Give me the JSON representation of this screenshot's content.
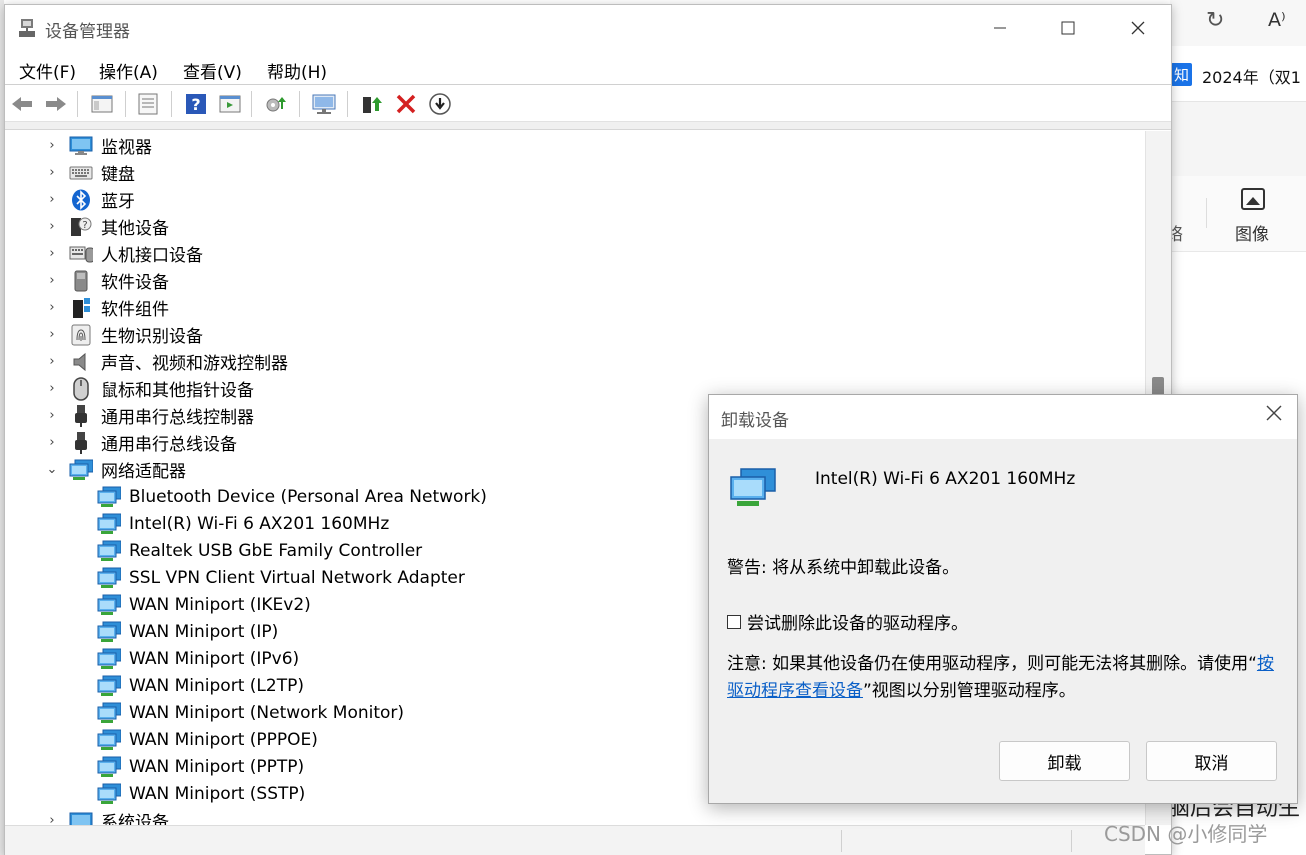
{
  "background": {
    "tab_badge": "知",
    "tab_text": "2024年（双1",
    "reader_icon": "A⁾",
    "tool_label": "图像",
    "tool_fragment": "络",
    "bottom_text": "脑后会自动生",
    "watermark": "CSDN @小修同学"
  },
  "device_manager": {
    "title": "设备管理器",
    "menu": [
      "文件(F)",
      "操作(A)",
      "查看(V)",
      "帮助(H)"
    ],
    "toolbar_icons": [
      "back-icon",
      "forward-icon",
      "show-hide-tree-icon",
      "properties-icon",
      "help-icon",
      "view-icon",
      "update-driver-icon",
      "scan-hardware-icon",
      "enable-device-icon",
      "uninstall-icon",
      "disable-icon"
    ],
    "tree": [
      {
        "label": "监视器",
        "icon": "monitor-icon",
        "expanded": false
      },
      {
        "label": "键盘",
        "icon": "keyboard-icon",
        "expanded": false
      },
      {
        "label": "蓝牙",
        "icon": "bluetooth-icon",
        "expanded": false
      },
      {
        "label": "其他设备",
        "icon": "unknown-device-icon",
        "expanded": false
      },
      {
        "label": "人机接口设备",
        "icon": "hid-icon",
        "expanded": false
      },
      {
        "label": "软件设备",
        "icon": "software-device-icon",
        "expanded": false
      },
      {
        "label": "软件组件",
        "icon": "software-component-icon",
        "expanded": false
      },
      {
        "label": "生物识别设备",
        "icon": "fingerprint-icon",
        "expanded": false
      },
      {
        "label": "声音、视频和游戏控制器",
        "icon": "speaker-icon",
        "expanded": false
      },
      {
        "label": "鼠标和其他指针设备",
        "icon": "mouse-icon",
        "expanded": false
      },
      {
        "label": "通用串行总线控制器",
        "icon": "usb-icon",
        "expanded": false
      },
      {
        "label": "通用串行总线设备",
        "icon": "usb-icon",
        "expanded": false
      },
      {
        "label": "网络适配器",
        "icon": "network-adapter-icon",
        "expanded": true
      }
    ],
    "network_children": [
      "Bluetooth Device (Personal Area Network)",
      "Intel(R) Wi-Fi 6 AX201 160MHz",
      "Realtek USB GbE Family Controller",
      "SSL VPN Client Virtual Network Adapter",
      "WAN Miniport (IKEv2)",
      "WAN Miniport (IP)",
      "WAN Miniport (IPv6)",
      "WAN Miniport (L2TP)",
      "WAN Miniport (Network Monitor)",
      "WAN Miniport (PPPOE)",
      "WAN Miniport (PPTP)",
      "WAN Miniport (SSTP)"
    ],
    "last_item": "系统设备"
  },
  "dialog": {
    "title": "卸载设备",
    "device_name": "Intel(R) Wi-Fi 6 AX201 160MHz",
    "warning": "警告: 将从系统中卸载此设备。",
    "checkbox_label": "尝试删除此设备的驱动程序。",
    "checkbox_checked": false,
    "note_prefix": "注意: 如果其他设备仍在使用驱动程序，则可能无法将其删除。请使用“",
    "note_link": "按驱动程序查看设备",
    "note_suffix": "”视图以分别管理驱动程序。",
    "uninstall_button": "卸载",
    "cancel_button": "取消"
  },
  "colors": {
    "link": "#0a5fc7",
    "uninstall_red": "#d42020",
    "network_icon_blue": "#2f8fd8"
  }
}
